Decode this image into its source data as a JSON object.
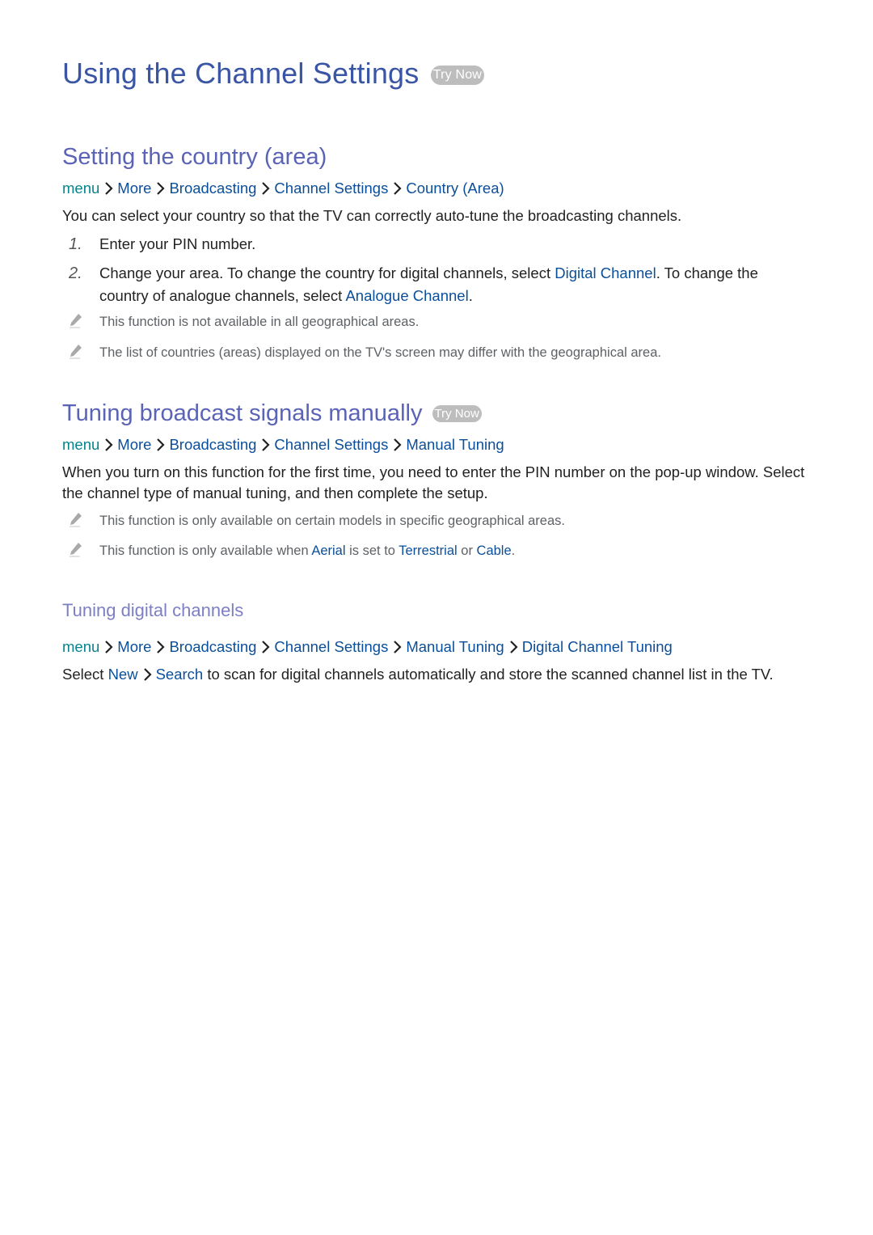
{
  "title": {
    "text": "Using the Channel Settings",
    "try_now": "Try Now"
  },
  "section_country": {
    "heading": "Setting the country (area)",
    "path": [
      "menu",
      "More",
      "Broadcasting",
      "Channel Settings",
      "Country (Area)"
    ],
    "intro": "You can select your country so that the TV can correctly auto-tune the broadcasting channels.",
    "steps": [
      {
        "num": "1.",
        "text": "Enter your PIN number."
      },
      {
        "num": "2.",
        "text_a": "Change your area. To change the country for digital channels, select ",
        "link_a": "Digital Channel",
        "text_b": ". To change the country of analogue channels, select ",
        "link_b": "Analogue Channel",
        "text_c": "."
      }
    ],
    "notes": [
      "This function is not available in all geographical areas.",
      "The list of countries (areas) displayed on the TV's screen may differ with the geographical area."
    ]
  },
  "section_manual": {
    "heading": "Tuning broadcast signals manually",
    "try_now": "Try Now",
    "path": [
      "menu",
      "More",
      "Broadcasting",
      "Channel Settings",
      "Manual Tuning"
    ],
    "intro": "When you turn on this function for the first time, you need to enter the PIN number on the pop-up window. Select the channel type of manual tuning, and then complete the setup.",
    "notes": [
      {
        "text": "This function is only available on certain models in specific geographical areas."
      },
      {
        "text_a": "This function is only available when ",
        "link_a": "Aerial",
        "text_b": " is set to ",
        "link_b": "Terrestrial",
        "text_c": " or ",
        "link_c": "Cable",
        "text_d": "."
      }
    ]
  },
  "section_digital": {
    "heading": "Tuning digital channels",
    "path": [
      "menu",
      "More",
      "Broadcasting",
      "Channel Settings",
      "Manual Tuning",
      "Digital Channel Tuning"
    ],
    "text_a": "Select ",
    "link_a": "New",
    "link_b": "Search",
    "text_b": " to scan for digital channels automatically and store the scanned channel list in the TV."
  },
  "colors": {
    "title": "#3a55a4",
    "heading": "#5a63b5",
    "subheading": "#7d7fc4",
    "link": "#0b4f9a",
    "menu": "#08838d",
    "note_text": "#5e6266",
    "try_now_bg": "#bdbdbd"
  }
}
